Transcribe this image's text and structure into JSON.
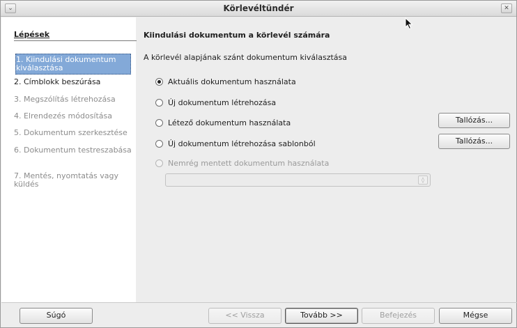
{
  "window": {
    "title": "Körlevéltündér",
    "menu_glyph": "⌄",
    "close_glyph": "✕"
  },
  "steps": {
    "heading": "Lépések",
    "items": [
      {
        "label": "1. Kiindulási dokumentum kiválasztása",
        "state": "active"
      },
      {
        "label": "2. Címblokk beszúrása",
        "state": "normal"
      },
      {
        "label": "3. Megszólítás létrehozása",
        "state": "disabled"
      },
      {
        "label": "4. Elrendezés módosítása",
        "state": "disabled"
      },
      {
        "label": "5. Dokumentum szerkesztése",
        "state": "disabled"
      },
      {
        "label": "6. Dokumentum testreszabása",
        "state": "disabled"
      },
      {
        "label": "7. Mentés, nyomtatás vagy küldés",
        "state": "disabled"
      }
    ]
  },
  "content": {
    "heading": "Kiindulási dokumentum a körlevél számára",
    "description": "A körlevél alapjának szánt dokumentum kiválasztása",
    "options": [
      {
        "label": "Aktuális dokumentum használata",
        "checked": true,
        "enabled": true
      },
      {
        "label": "Új dokumentum létrehozása",
        "checked": false,
        "enabled": true
      },
      {
        "label": "Létező dokumentum használata",
        "checked": false,
        "enabled": true
      },
      {
        "label": "Új dokumentum létrehozása sablonból",
        "checked": false,
        "enabled": true
      },
      {
        "label": "Nemrég mentett dokumentum használata",
        "checked": false,
        "enabled": false
      }
    ],
    "browse_label_1": "Tallózás...",
    "browse_label_2": "Tallózás...",
    "recent_combo_value": ""
  },
  "footer": {
    "help": "Súgó",
    "back": "<< Vissza",
    "next": "Tovább >>",
    "finish": "Befejezés",
    "cancel": "Mégse"
  }
}
